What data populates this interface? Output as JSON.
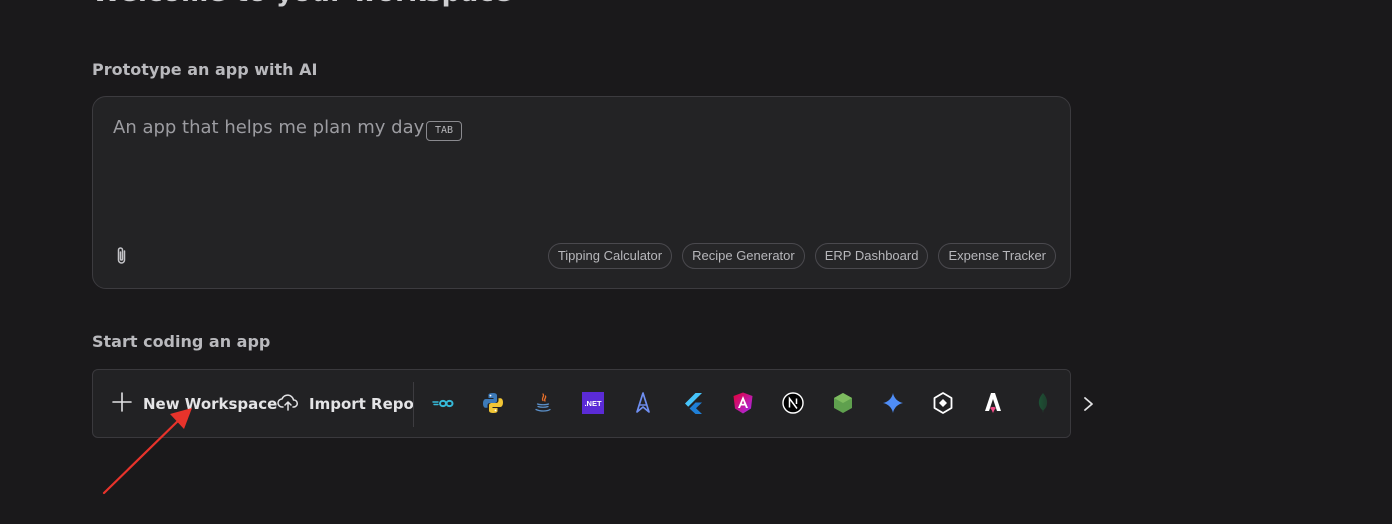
{
  "page": {
    "cut_heading": "Welcome to your workspace"
  },
  "prototype": {
    "title": "Prototype an app with AI",
    "placeholder": "An app that helps me plan my day",
    "tab_hint": "TAB",
    "attach_icon": "paperclip-icon",
    "suggestions": [
      "Tipping Calculator",
      "Recipe Generator",
      "ERP Dashboard",
      "Expense Tracker"
    ]
  },
  "coding": {
    "title": "Start coding an app",
    "new_workspace_label": "New Workspace",
    "new_workspace_icon": "plus-icon",
    "import_repo_label": "Import Repo",
    "import_repo_icon": "cloud-upload-icon",
    "technologies": [
      {
        "name": "Go",
        "icon": "go-icon"
      },
      {
        "name": "Python",
        "icon": "python-icon"
      },
      {
        "name": "Java",
        "icon": "java-icon"
      },
      {
        "name": ".NET",
        "icon": "dotnet-icon",
        "label": ".NET"
      },
      {
        "name": "Astro",
        "icon": "astro-icon"
      },
      {
        "name": "Flutter",
        "icon": "flutter-icon"
      },
      {
        "name": "Angular",
        "icon": "angular-icon"
      },
      {
        "name": "Next.js",
        "icon": "nextjs-icon"
      },
      {
        "name": "Node.js",
        "icon": "nodejs-icon"
      },
      {
        "name": "Gemini",
        "icon": "gemini-icon"
      },
      {
        "name": "Genkit",
        "icon": "genkit-icon"
      },
      {
        "name": "Astro Sketch",
        "icon": "astro-a-icon"
      },
      {
        "name": "MongoDB",
        "icon": "mongodb-icon"
      }
    ],
    "next_icon": "chevron-right-icon"
  },
  "annotation": {
    "color": "#e8332b"
  },
  "colors": {
    "background": "#1a191b",
    "card": "#232325",
    "accent_red": "#e8332b"
  }
}
